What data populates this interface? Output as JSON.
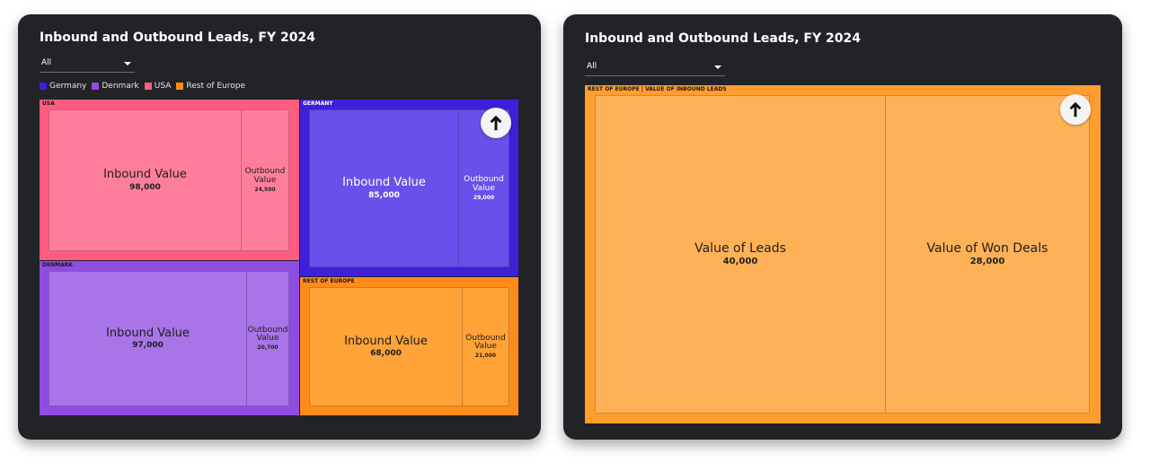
{
  "left_panel": {
    "title": "Inbound and Outbound Leads, FY 2024",
    "filter_value": "All",
    "legend": [
      {
        "label": "Germany",
        "color": "#3f1fd8"
      },
      {
        "label": "Denmark",
        "color": "#8e4ce0"
      },
      {
        "label": "USA",
        "color": "#ff5c80"
      },
      {
        "label": "Rest of Europe",
        "color": "#ff8c1a"
      }
    ],
    "groups": {
      "usa": "USA",
      "denmark": "DENMARK",
      "germany": "GERMANY",
      "rest_of_europe": "REST OF EUROPE"
    },
    "leaves": {
      "usa_inbound": {
        "label": "Inbound Value",
        "value": "98,000"
      },
      "usa_outbound": {
        "label": "Outbound Value",
        "value": "24,500"
      },
      "denmark_inbound": {
        "label": "Inbound Value",
        "value": "97,000"
      },
      "denmark_outbound": {
        "label": "Outbound Value",
        "value": "20,700"
      },
      "germany_inbound": {
        "label": "Inbound Value",
        "value": "85,000"
      },
      "germany_outbound": {
        "label": "Outbound Value",
        "value": "29,000"
      },
      "roe_inbound": {
        "label": "Inbound Value",
        "value": "68,000"
      },
      "roe_outbound": {
        "label": "Outbound Value",
        "value": "21,000"
      }
    },
    "up_icon": "arrow-up-icon"
  },
  "right_panel": {
    "title": "Inbound and Outbound Leads, FY 2024",
    "filter_value": "All",
    "breadcrumb": "REST OF EUROPE | VALUE OF INBOUND LEADS",
    "leaves": {
      "leads": {
        "label": "Value of Leads",
        "value": "40,000"
      },
      "won": {
        "label": "Value of Won Deals",
        "value": "28,000"
      }
    },
    "up_icon": "arrow-up-icon"
  },
  "chart_data": [
    {
      "type": "treemap",
      "title": "Inbound and Outbound Leads, FY 2024",
      "filter": "All",
      "series": [
        {
          "name": "USA",
          "color": "#ff5c80",
          "items": [
            {
              "label": "Inbound Value",
              "value": 98000
            },
            {
              "label": "Outbound Value",
              "value": 24500
            }
          ]
        },
        {
          "name": "Denmark",
          "color": "#8e4ce0",
          "items": [
            {
              "label": "Inbound Value",
              "value": 97000
            },
            {
              "label": "Outbound Value",
              "value": 20700
            }
          ]
        },
        {
          "name": "Germany",
          "color": "#3f1fd8",
          "items": [
            {
              "label": "Inbound Value",
              "value": 85000
            },
            {
              "label": "Outbound Value",
              "value": 29000
            }
          ]
        },
        {
          "name": "Rest of Europe",
          "color": "#ff8c1a",
          "items": [
            {
              "label": "Inbound Value",
              "value": 68000
            },
            {
              "label": "Outbound Value",
              "value": 21000
            }
          ]
        }
      ],
      "legend_position": "top-left"
    },
    {
      "type": "treemap",
      "title": "Inbound and Outbound Leads, FY 2024",
      "filter": "All",
      "drilldown_path": "REST OF EUROPE | VALUE OF INBOUND LEADS",
      "color": "#ff9d2e",
      "items": [
        {
          "label": "Value of Leads",
          "value": 40000
        },
        {
          "label": "Value of Won Deals",
          "value": 28000
        }
      ]
    }
  ]
}
